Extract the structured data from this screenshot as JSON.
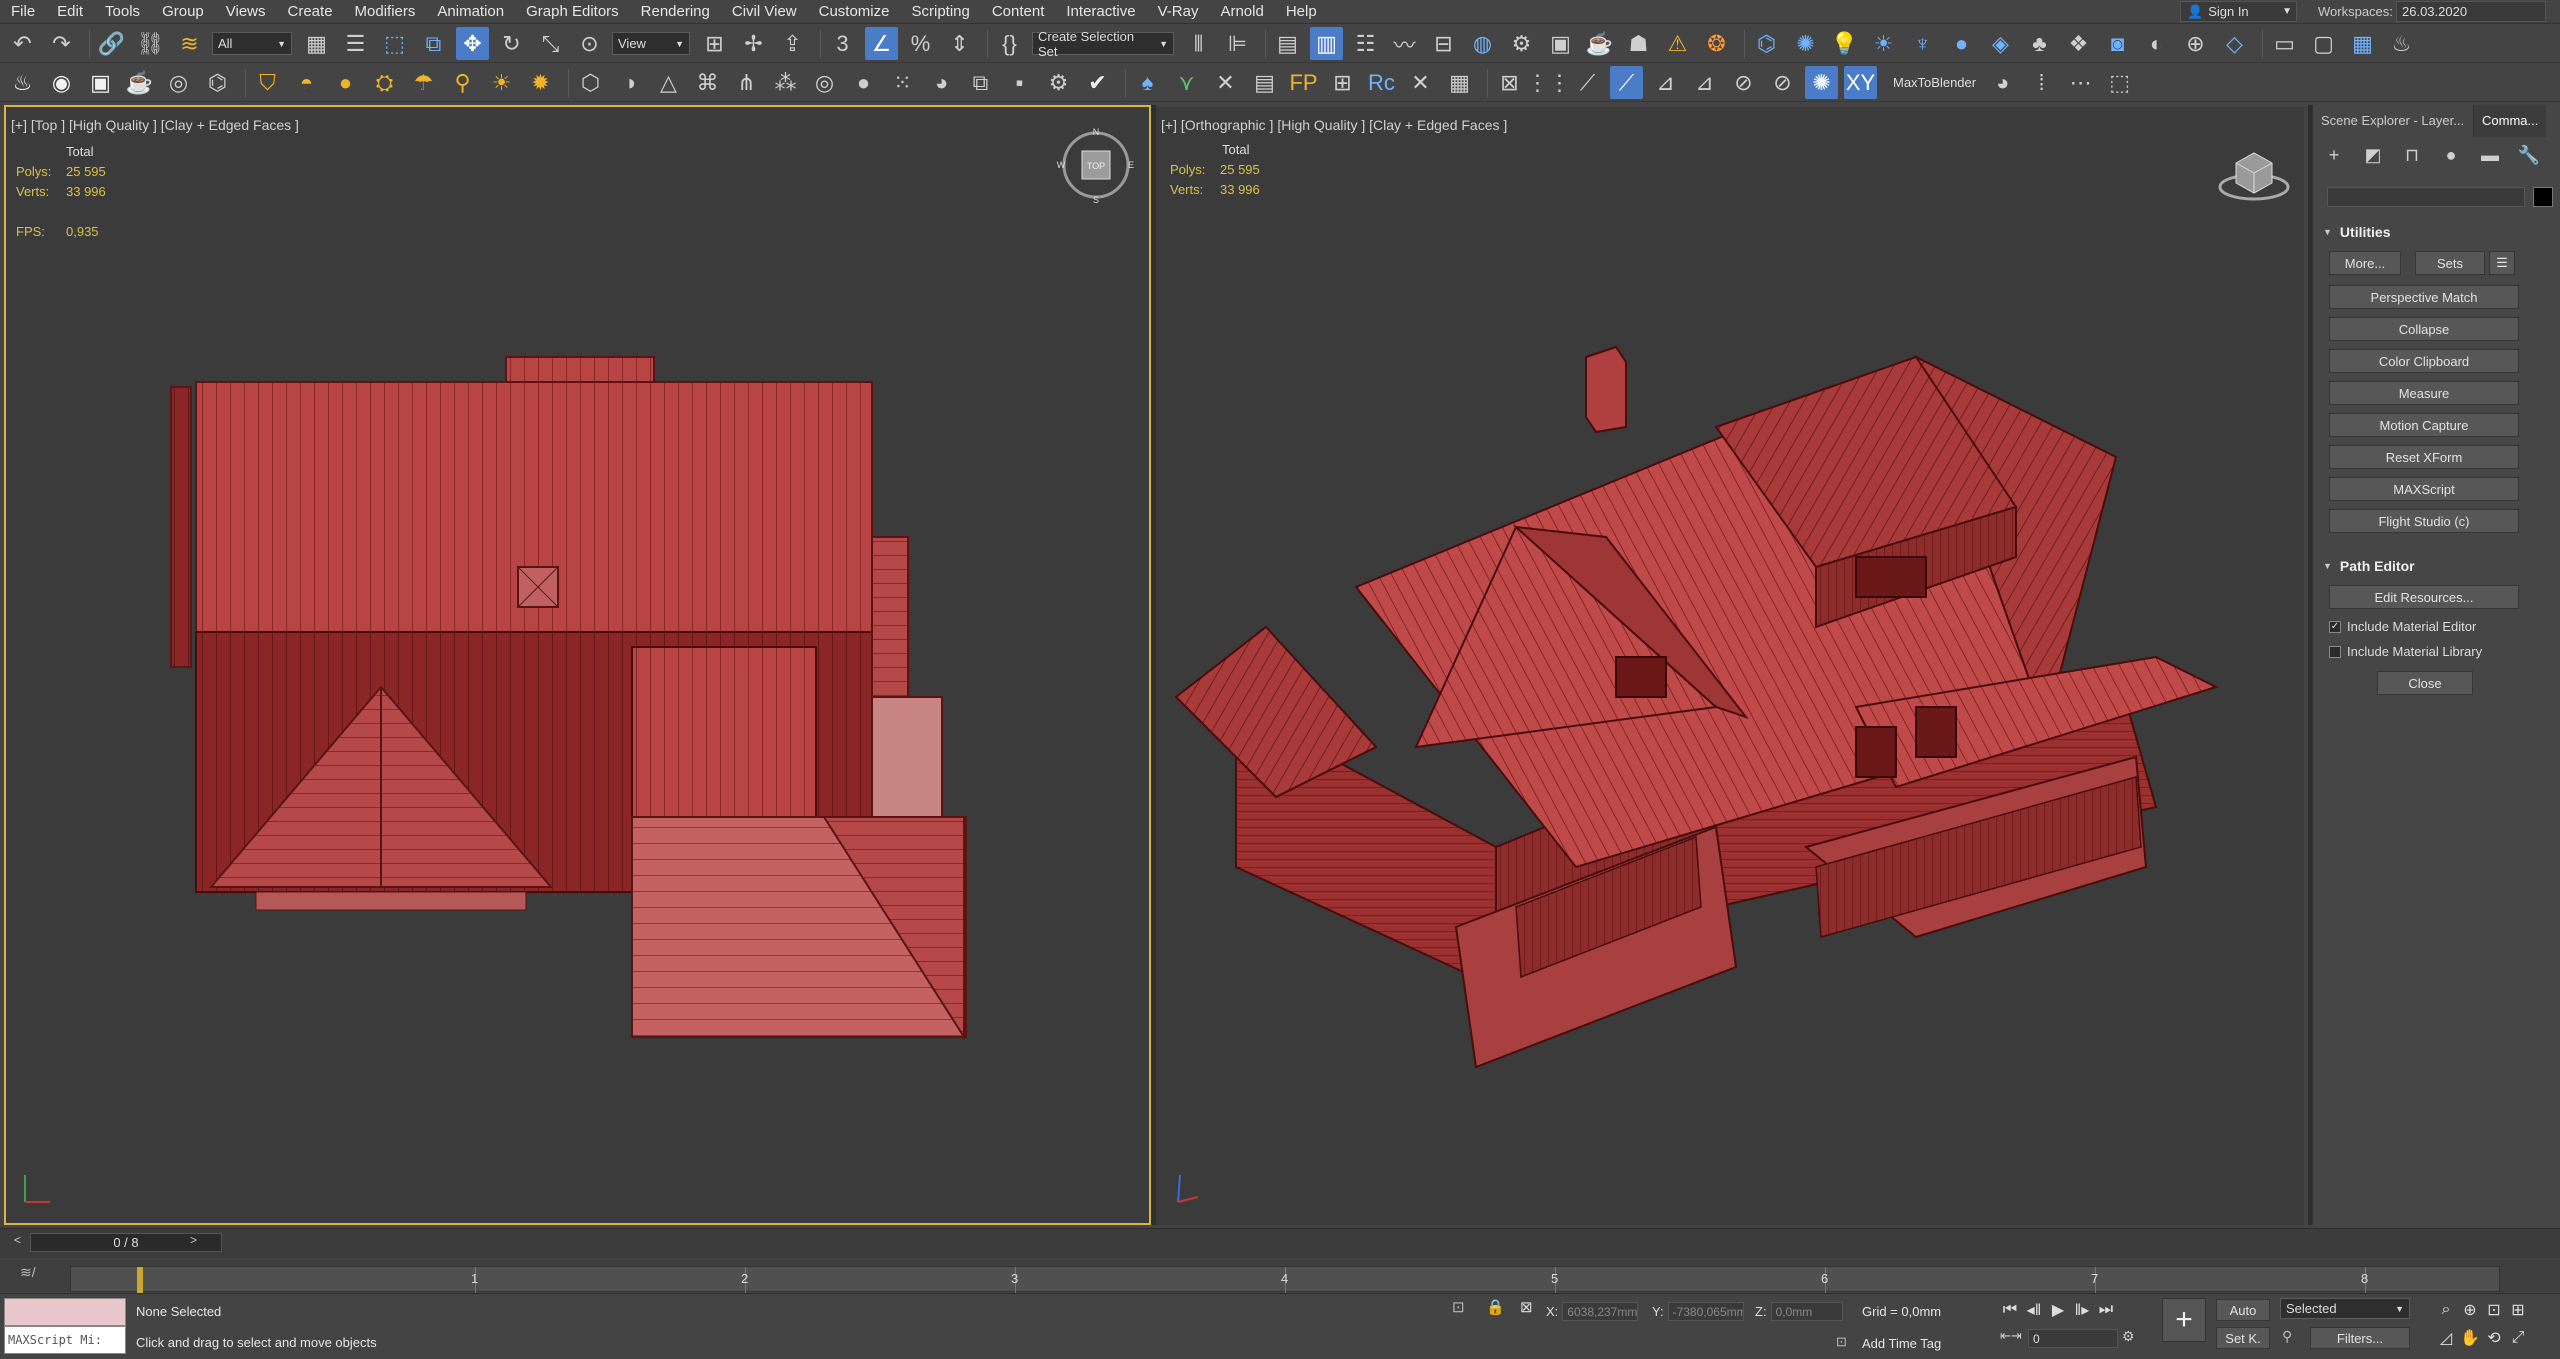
{
  "menu": [
    "File",
    "Edit",
    "Tools",
    "Group",
    "Views",
    "Create",
    "Modifiers",
    "Animation",
    "Graph Editors",
    "Rendering",
    "Civil View",
    "Customize",
    "Scripting",
    "Content",
    "Interactive",
    "V-Ray",
    "Arnold",
    "Help"
  ],
  "account": {
    "signin": "Sign In",
    "workspaces_label": "Workspaces:",
    "workspace": "26.03.2020"
  },
  "toolbar": {
    "filter": "All",
    "refcoord": "View",
    "selection_set": "Create Selection Set",
    "plugin_label": "MaxToBlender"
  },
  "viewport_left": {
    "label": "[+] [Top ] [High Quality ] [Clay + Edged Faces ]",
    "total": "Total",
    "polys_k": "Polys:",
    "polys_v": "25 595",
    "verts_k": "Verts:",
    "verts_v": "33 996",
    "fps_k": "FPS:",
    "fps_v": "0,935",
    "cube": "TOP",
    "cube_n": "N",
    "cube_s": "S",
    "cube_w": "W",
    "cube_e": "E"
  },
  "viewport_right": {
    "label": "[+] [Orthographic ] [High Quality ] [Clay + Edged Faces ]",
    "total": "Total",
    "polys_k": "Polys:",
    "polys_v": "25 595",
    "verts_k": "Verts:",
    "verts_v": "33 996"
  },
  "command_panel": {
    "tab_scene": "Scene Explorer - Layer...",
    "tab_command": "Comma...",
    "utilities_title": "Utilities",
    "more_btn": "More...",
    "sets_btn": "Sets",
    "utilities": [
      "Perspective Match",
      "Collapse",
      "Color Clipboard",
      "Measure",
      "Motion Capture",
      "Reset XForm",
      "MAXScript",
      "Flight Studio (c)"
    ],
    "path_editor_title": "Path Editor",
    "edit_resources": "Edit Resources...",
    "include_material_editor": "Include Material Editor",
    "include_material_library": "Include Material Library",
    "close_btn": "Close",
    "material_editor_checked": true,
    "material_library_checked": false
  },
  "timeline": {
    "slider": "0 / 8",
    "frames": [
      "1",
      "2",
      "3",
      "4",
      "5",
      "6",
      "7",
      "8"
    ],
    "current": 0
  },
  "status": {
    "maxscript": "MAXScript Mi:",
    "none_selected": "None Selected",
    "prompt": "Click and drag to select and move objects",
    "x_label": "X:",
    "x_value": "6038,237mm",
    "y_label": "Y:",
    "y_value": "-7380,065mm",
    "z_label": "Z:",
    "z_value": "0,0mm",
    "grid": "Grid = 0,0mm",
    "add_time_tag": "Add Time Tag",
    "auto_btn": "Auto",
    "set_key_btn": "Set K.",
    "key_filter": "Selected",
    "filters_btn": "Filters...",
    "frame_field": "0"
  },
  "colors": {
    "house": "#b84444",
    "house_dark": "#8a2424",
    "viewport_bg": "#3b3b3b",
    "active_border": "#d8b642",
    "accent": "#4a7cc7"
  }
}
